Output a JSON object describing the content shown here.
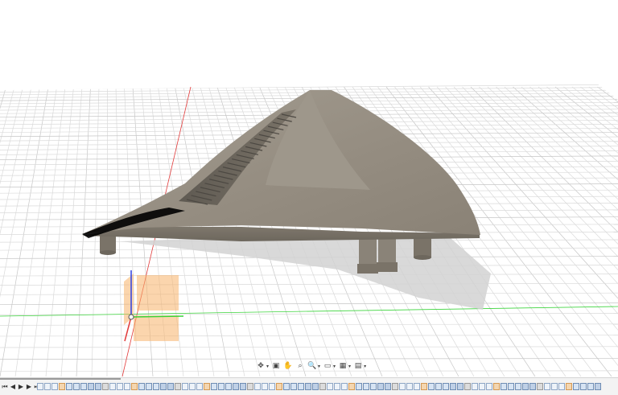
{
  "viewport": {
    "background": "#ffffff",
    "grid_color": "#d9d9d9",
    "grid_major_color": "#c4c4c4",
    "x_axis_color": "#e23b3b",
    "y_axis_color": "#3bd43b",
    "z_axis_color": "#2d3de0",
    "model_color": "#8f877a",
    "shadow_color": "#cfcfcf",
    "selection_plane_color": "#f7b36a"
  },
  "model": {
    "name": "curved-shroud-with-vents",
    "vent_slots": 22,
    "legs": 3,
    "clips": 2
  },
  "navigation_toolbar": {
    "items": [
      {
        "name": "orbit-icon",
        "glyph": "✥",
        "has_dropdown": true
      },
      {
        "name": "look-at-icon",
        "glyph": "▣",
        "has_dropdown": false
      },
      {
        "name": "pan-icon",
        "glyph": "✋",
        "has_dropdown": false
      },
      {
        "name": "zoom-window-icon",
        "glyph": "⌕",
        "has_dropdown": false
      },
      {
        "name": "zoom-icon",
        "glyph": "🔍",
        "has_dropdown": true
      },
      {
        "name": "display-settings-icon",
        "glyph": "▭",
        "has_dropdown": true
      },
      {
        "name": "grid-settings-icon",
        "glyph": "▦",
        "has_dropdown": true
      },
      {
        "name": "viewports-icon",
        "glyph": "▤",
        "has_dropdown": true
      }
    ]
  },
  "timeline": {
    "controls": [
      {
        "name": "timeline-first-icon",
        "glyph": "⏮"
      },
      {
        "name": "timeline-prev-icon",
        "glyph": "◀"
      },
      {
        "name": "timeline-play-icon",
        "glyph": "▶"
      },
      {
        "name": "timeline-next-icon",
        "glyph": "▶"
      },
      {
        "name": "timeline-last-icon",
        "glyph": "⏭"
      }
    ],
    "feature_count": 78
  }
}
